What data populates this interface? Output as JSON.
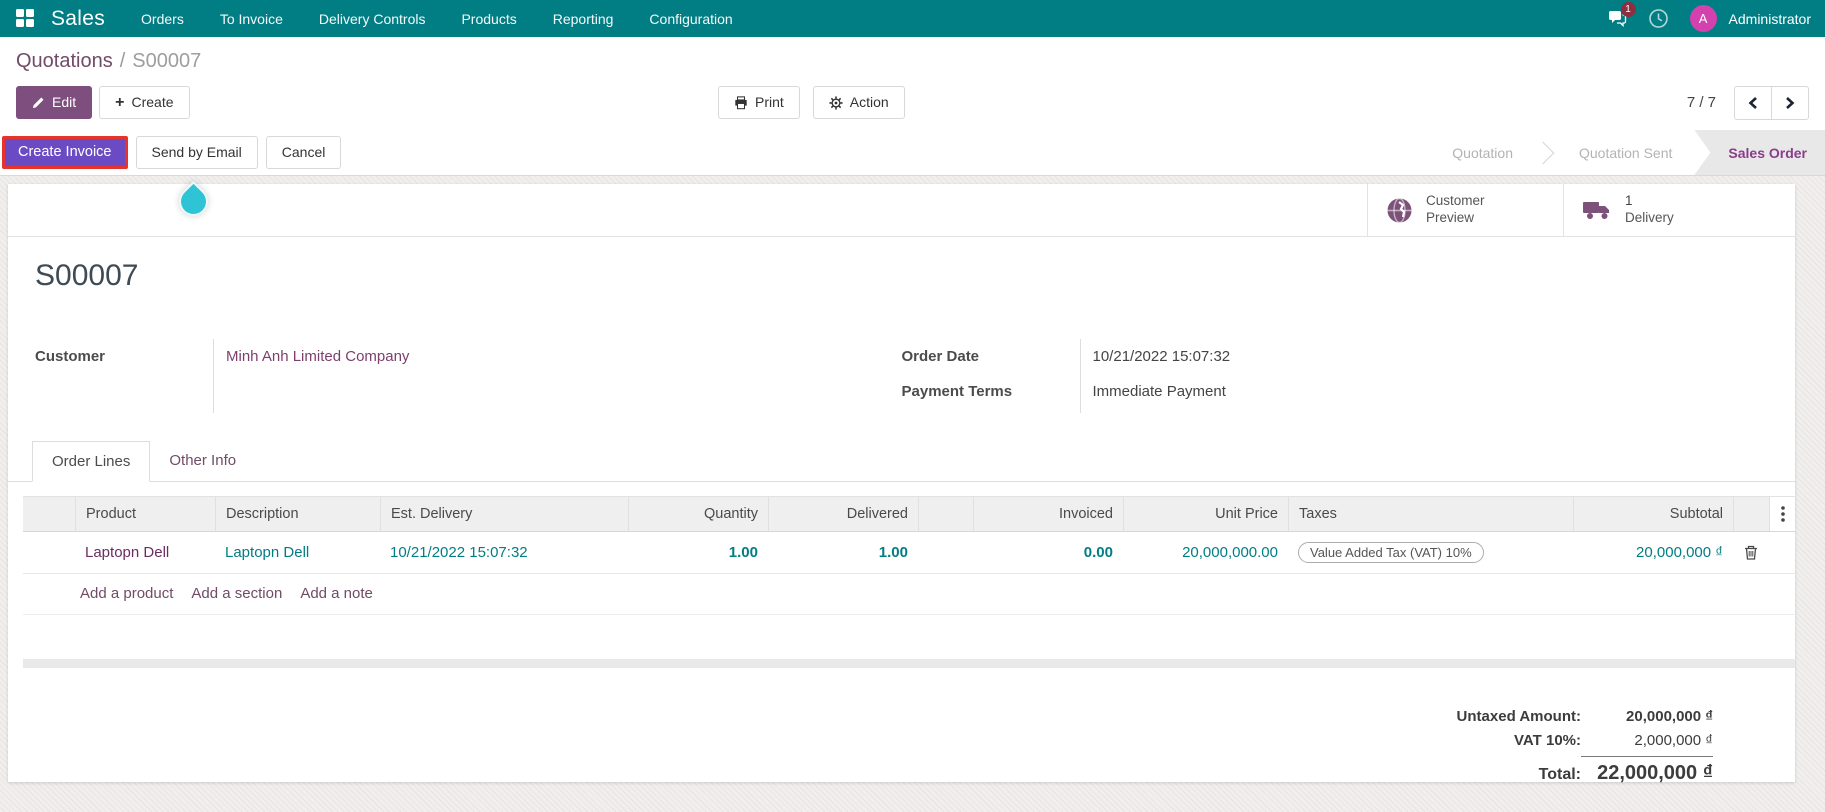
{
  "colors": {
    "navbar_teal": "#017e84",
    "primary_purple": "#7d4e7e",
    "violet_button": "#6a4bc4",
    "highlight_red": "#e5342c",
    "link_teal": "#017e84",
    "link_purple": "#714B67",
    "product_link": "#6b2c62",
    "active_stage": "#8a3d8a",
    "avatar_magenta": "#d241ae",
    "droplet_cyan": "#2ec4d6"
  },
  "navbar": {
    "brand": "Sales",
    "items": [
      "Orders",
      "To Invoice",
      "Delivery Controls",
      "Products",
      "Reporting",
      "Configuration"
    ],
    "message_badge": "1",
    "avatar_initial": "A",
    "user_name": "Administrator"
  },
  "breadcrumb": {
    "parent": "Quotations",
    "separator": "/",
    "current": "S00007"
  },
  "actions": {
    "edit": "Edit",
    "create": "Create",
    "print": "Print",
    "action": "Action",
    "pager": "7 / 7"
  },
  "workflow": {
    "create_invoice": "Create Invoice",
    "send_by_email": "Send by Email",
    "cancel": "Cancel",
    "stages": [
      {
        "label": "Quotation",
        "active": false
      },
      {
        "label": "Quotation Sent",
        "active": false
      },
      {
        "label": "Sales Order",
        "active": true
      }
    ]
  },
  "stat_buttons": {
    "customer_preview_line1": "Customer",
    "customer_preview_line2": "Preview",
    "delivery_count": "1",
    "delivery_label": "Delivery"
  },
  "record": {
    "name": "S00007",
    "customer_label": "Customer",
    "customer": "Minh Anh Limited Company",
    "order_date_label": "Order Date",
    "order_date": "10/21/2022 15:07:32",
    "payment_terms_label": "Payment Terms",
    "payment_terms": "Immediate Payment"
  },
  "tabs": {
    "order_lines": "Order Lines",
    "other_info": "Other Info"
  },
  "order_lines": {
    "headers": {
      "product": "Product",
      "description": "Description",
      "est_delivery": "Est. Delivery",
      "quantity": "Quantity",
      "delivered": "Delivered",
      "invoiced": "Invoiced",
      "unit_price": "Unit Price",
      "taxes": "Taxes",
      "subtotal": "Subtotal"
    },
    "rows": [
      {
        "product": "Laptopn Dell",
        "description": "Laptopn Dell",
        "est_delivery": "10/21/2022 15:07:32",
        "quantity": "1.00",
        "delivered": "1.00",
        "invoiced": "0.00",
        "unit_price": "20,000,000.00",
        "taxes": "Value Added Tax (VAT) 10%",
        "subtotal": "20,000,000 ₫"
      }
    ],
    "add_product": "Add a product",
    "add_section": "Add a section",
    "add_note": "Add a note"
  },
  "totals": {
    "untaxed_label": "Untaxed Amount:",
    "untaxed_value": "20,000,000 ₫",
    "vat_label": "VAT 10%:",
    "vat_value": "2,000,000 ₫",
    "total_label": "Total:",
    "total_value": "22,000,000 ₫"
  }
}
